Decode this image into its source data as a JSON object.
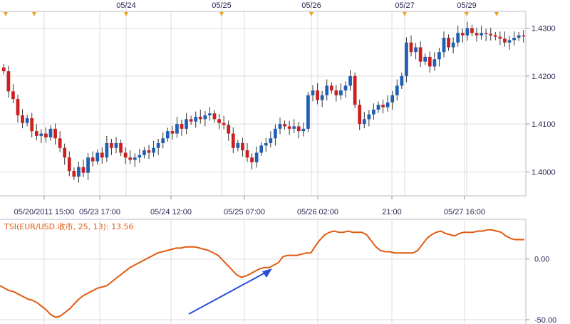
{
  "colors": {
    "up": "#1f5fb4",
    "down": "#cc1f1f",
    "wick": "#333333",
    "grid": "#dcdcdc",
    "axis": "#b8b8c8",
    "tsi": "#e05a10",
    "arrow": "#2a4fd6",
    "marker": "#f0a020"
  },
  "chart_data": [
    {
      "type": "candlestick",
      "x_ticks": [
        "05/20/2011 15:00",
        "05/23 17:00",
        "05/24 12:00",
        "05/25 07:00",
        "05/26 02:00",
        "21:00",
        "05/27 16:00"
      ],
      "date_markers": [
        "05/24",
        "05/25",
        "05/26",
        "05/27",
        "05/29"
      ],
      "ylim": [
        1.395,
        1.4335
      ],
      "y_ticks": [
        "1.4000",
        "1.4100",
        "1.4200",
        "1.4300"
      ],
      "closes": [
        1.421,
        1.4168,
        1.4152,
        1.4118,
        1.4102,
        1.4112,
        1.4085,
        1.4075,
        1.408,
        1.4072,
        1.409,
        1.407,
        1.405,
        1.403,
        1.4002,
        1.399,
        1.401,
        1.3998,
        1.403,
        1.4022,
        1.404,
        1.403,
        1.406,
        1.405,
        1.406,
        1.404,
        1.403,
        1.4025,
        1.403,
        1.4035,
        1.4045,
        1.404,
        1.405,
        1.406,
        1.407,
        1.4085,
        1.408,
        1.41,
        1.409,
        1.411,
        1.4105,
        1.4115,
        1.411,
        1.4118,
        1.4122,
        1.411,
        1.4102,
        1.4098,
        1.408,
        1.405,
        1.406,
        1.4045,
        1.403,
        1.402,
        1.404,
        1.4055,
        1.406,
        1.407,
        1.409,
        1.41,
        1.4095,
        1.409,
        1.4095,
        1.4085,
        1.409,
        1.416,
        1.417,
        1.415,
        1.416,
        1.418,
        1.417,
        1.416,
        1.417,
        1.418,
        1.42,
        1.414,
        1.41,
        1.411,
        1.412,
        1.413,
        1.414,
        1.4135,
        1.4145,
        1.416,
        1.418,
        1.42,
        1.427,
        1.425,
        1.426,
        1.423,
        1.424,
        1.422,
        1.4235,
        1.425,
        1.428,
        1.426,
        1.427,
        1.429,
        1.4285,
        1.43,
        1.429,
        1.4285,
        1.429,
        1.4288,
        1.4285,
        1.4282,
        1.4278,
        1.427,
        1.4275,
        1.428,
        1.4285,
        1.4283
      ]
    },
    {
      "type": "line",
      "label": "TSI(EUR/USD.收市, 25, 13): 13.56",
      "ylim": [
        -50,
        28
      ],
      "y_ticks": [
        "0.00",
        "-50.00"
      ],
      "values": [
        -22,
        -24,
        -26,
        -27,
        -29,
        -31,
        -33,
        -34,
        -36,
        -39,
        -42,
        -46,
        -48,
        -47,
        -44,
        -41,
        -37,
        -33,
        -30,
        -28,
        -26,
        -24,
        -23,
        -22,
        -19,
        -16,
        -13,
        -10,
        -7,
        -5,
        -3,
        -1,
        1,
        3,
        5,
        6,
        7,
        8,
        9,
        9,
        10,
        10,
        10,
        9,
        8,
        7,
        5,
        3,
        -1,
        -5,
        -9,
        -13,
        -15,
        -14,
        -12,
        -10,
        -8,
        -7,
        -7,
        -5,
        -3,
        2,
        3,
        3,
        3,
        4,
        5,
        5,
        11,
        16,
        20,
        22,
        23,
        22,
        22,
        23,
        22,
        22,
        22,
        20,
        15,
        10,
        7,
        6,
        6,
        5,
        5,
        5,
        5,
        5,
        7,
        12,
        17,
        20,
        22,
        23,
        21,
        20,
        19,
        21,
        22,
        22,
        22,
        23,
        23,
        24,
        24,
        23,
        22,
        19,
        17,
        16,
        16,
        16
      ]
    }
  ]
}
